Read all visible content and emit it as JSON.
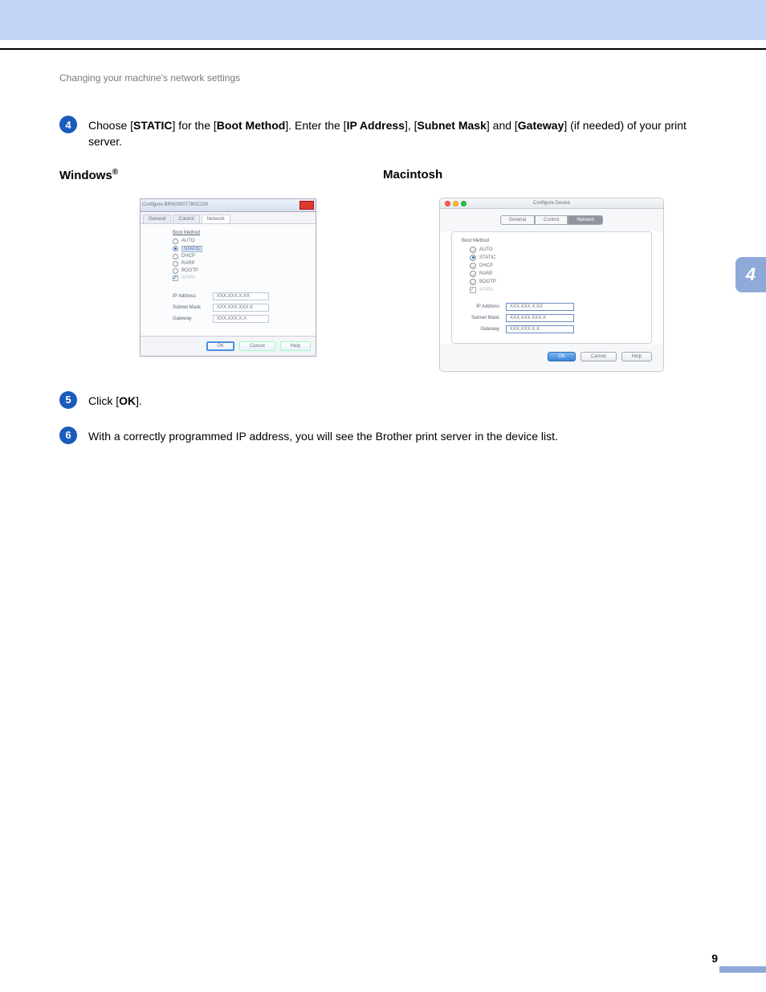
{
  "header": {
    "section_title": "Changing your machine's network settings"
  },
  "steps": {
    "s4": {
      "num": "4",
      "pre": "Choose [",
      "b1": "STATIC",
      "mid1": "] for the [",
      "b2": "Boot Method",
      "mid2": "]. Enter the [",
      "b3": "IP Address",
      "mid3": "], [",
      "b4": "Subnet Mask",
      "mid4": "] and [",
      "b5": "Gateway",
      "post": "] (if needed) of your print server."
    },
    "s5": {
      "num": "5",
      "pre": "Click [",
      "b1": "OK",
      "post": "]."
    },
    "s6": {
      "num": "6",
      "text": "With a correctly programmed IP address, you will see the Brother print server in the device list."
    }
  },
  "columns": {
    "windows": {
      "title": "Windows",
      "sup": "®"
    },
    "mac": {
      "title": "Macintosh"
    }
  },
  "win_dialog": {
    "title": "Configure BRN000077B0C200",
    "tabs": [
      "General",
      "Control",
      "Network"
    ],
    "boot_method_label": "Boot Method",
    "radios": [
      "AUTO",
      "STATIC",
      "DHCP",
      "RARP",
      "BOOTP"
    ],
    "apipa_label": "APIPA",
    "fields": {
      "ip": {
        "label": "IP Address",
        "value": "XXX.XXX.X.XX"
      },
      "subnet": {
        "label": "Subnet Mask",
        "value": "XXX.XXX.XXX.X"
      },
      "gateway": {
        "label": "Gateway",
        "value": "XXX.XXX.X.X"
      }
    },
    "buttons": {
      "ok": "OK",
      "cancel": "Cancel",
      "help": "Help"
    }
  },
  "mac_dialog": {
    "title": "Configure Device",
    "segments": [
      "General",
      "Control",
      "Network"
    ],
    "boot_method_label": "Boot Method",
    "radios": [
      "AUTO",
      "STATIC",
      "DHCP",
      "RARP",
      "BOOTP"
    ],
    "apipa_label": "APIPA",
    "fields": {
      "ip": {
        "label": "IP Address",
        "value": "XXX.XXX.X.XX"
      },
      "subnet": {
        "label": "Subnet Mask",
        "value": "XXX.XXX.XXX.X"
      },
      "gateway": {
        "label": "Gateway",
        "value": "XXX.XXX.X.X"
      }
    },
    "buttons": {
      "ok": "OK",
      "cancel": "Cancel",
      "help": "Help"
    }
  },
  "side_tab": "4",
  "page_number": "9"
}
